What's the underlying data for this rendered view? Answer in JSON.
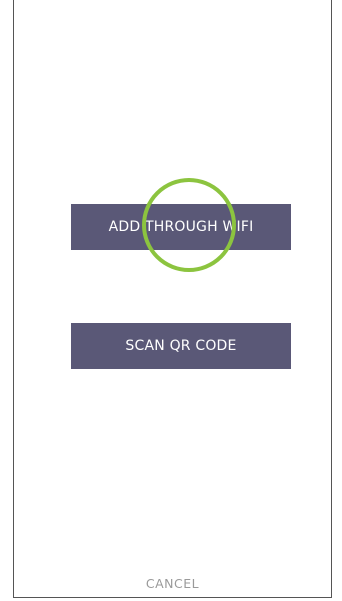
{
  "actions": {
    "add_wifi_label": "ADD THROUGH WIFI",
    "scan_qr_label": "SCAN QR CODE",
    "cancel_label": "CANCEL"
  },
  "colors": {
    "button_bg": "#5a5877",
    "button_text": "#ffffff",
    "tap_indicator": "#8cc43f",
    "cancel_text": "#9a9a9a"
  }
}
